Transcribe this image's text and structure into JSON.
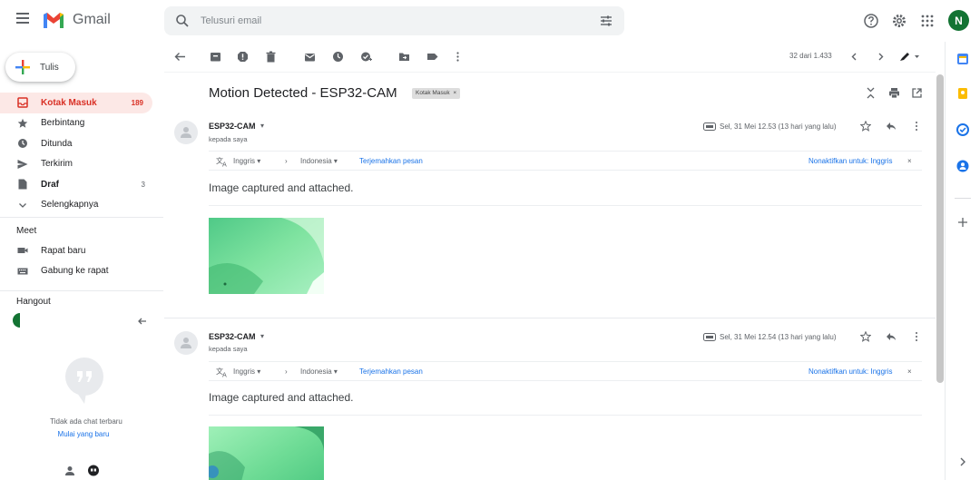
{
  "header": {
    "app_name": "Gmail",
    "search_placeholder": "Telusuri email",
    "avatar_letter": "N"
  },
  "sidebar": {
    "compose_label": "Tulis",
    "items": [
      {
        "label": "Kotak Masuk",
        "count": "189",
        "icon": "inbox-icon"
      },
      {
        "label": "Berbintang",
        "count": "",
        "icon": "star-icon"
      },
      {
        "label": "Ditunda",
        "count": "",
        "icon": "clock-icon"
      },
      {
        "label": "Terkirim",
        "count": "",
        "icon": "send-icon"
      },
      {
        "label": "Draf",
        "count": "3",
        "icon": "draft-icon"
      },
      {
        "label": "Selengkapnya",
        "count": "",
        "icon": "chevron-down-icon"
      }
    ],
    "meet_title": "Meet",
    "meet_items": [
      {
        "label": "Rapat baru",
        "icon": "video-icon"
      },
      {
        "label": "Gabung ke rapat",
        "icon": "keyboard-icon"
      }
    ],
    "hangout_title": "Hangout",
    "no_chat_text": "Tidak ada chat terbaru",
    "start_new_link": "Mulai yang baru"
  },
  "toolbar": {
    "pager": "32 dari 1.433"
  },
  "thread": {
    "subject": "Motion Detected - ESP32-CAM",
    "label": "Kotak Masuk",
    "messages": [
      {
        "sender": "ESP32-CAM",
        "to": "kepada saya",
        "date": "Sel, 31 Mei 12.53 (13 hari yang lalu)",
        "translate_from": "Inggris",
        "translate_to": "Indonesia",
        "translate_link": "Terjemahkan pesan",
        "translate_off": "Nonaktifkan untuk: Inggris",
        "body": "Image captured and attached."
      },
      {
        "sender": "ESP32-CAM",
        "to": "kepada saya",
        "date": "Sel, 31 Mei 12.54 (13 hari yang lalu)",
        "translate_from": "Inggris",
        "translate_to": "Indonesia",
        "translate_link": "Terjemahkan pesan",
        "translate_off": "Nonaktifkan untuk: Inggris",
        "body": "Image captured and attached."
      }
    ]
  },
  "colors": {
    "accent_red": "#d93025",
    "link_blue": "#1a73e8",
    "avatar_green": "#137333",
    "attachment_green": "#5fd68a"
  }
}
